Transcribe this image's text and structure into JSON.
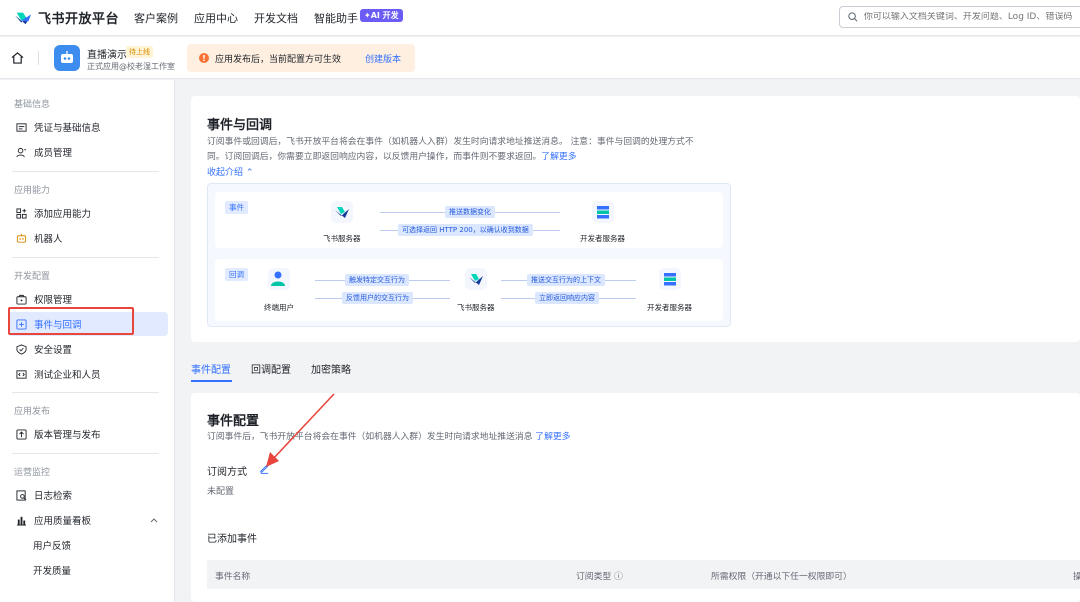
{
  "topnav": {
    "brand": "飞书开放平台",
    "items": [
      "客户案例",
      "应用中心",
      "开发文档",
      "智能助手"
    ],
    "ai_badge": "✦AI 开发",
    "search_placeholder": "你可以输入文档关键词、开发问题、Log ID、错误码"
  },
  "app": {
    "name": "直播演示",
    "status_badge": "待上线",
    "subtitle": "正式应用@校老湿工作室"
  },
  "notice": {
    "text": "应用发布后，当前配置方可生效",
    "link": "创建版本"
  },
  "sidebar": {
    "groups": [
      {
        "title": "基础信息",
        "items": [
          "凭证与基础信息",
          "成员管理"
        ]
      },
      {
        "title": "应用能力",
        "items": [
          "添加应用能力",
          "机器人"
        ]
      },
      {
        "title": "开发配置",
        "items": [
          "权限管理",
          "事件与回调",
          "安全设置",
          "测试企业和人员"
        ]
      },
      {
        "title": "应用发布",
        "items": [
          "版本管理与发布"
        ]
      },
      {
        "title": "运营监控",
        "items": [
          "日志检索",
          "应用质量看板",
          "用户反馈",
          "开发质量"
        ]
      }
    ]
  },
  "intro": {
    "title": "事件与回调",
    "desc_line1": "订阅事件或回调后，飞书开放平台将会在事件（如机器人入群）发生时向请求地址推送消息。 注意：事件与回调的处理方式不",
    "desc_line2": "同。订阅回调后，你需要立即返回响应内容，以反馈用户操作，而事件则不要求返回。",
    "learn_more": "了解更多",
    "collapse": "收起介绍 ⌃"
  },
  "diagram": {
    "event_tag": "事件",
    "callback_tag": "回调",
    "event_push": "推送数据变化",
    "event_return": "可选择返回 HTTP 200，以确认收到数据",
    "feishu_server": "飞书服务器",
    "dev_server": "开发者服务器",
    "end_user": "终端用户",
    "trigger": "触发特定交互行为",
    "feedback": "反馈用户的交互行为",
    "push_context": "推送交互行为的上下文",
    "return_now": "立即返回响应内容"
  },
  "tabs": [
    "事件配置",
    "回调配置",
    "加密策略"
  ],
  "event_config": {
    "title": "事件配置",
    "desc": "订阅事件后，飞书开放平台将会在事件（如机器人入群）发生时向请求地址推送消息",
    "learn_more": "了解更多",
    "sub_method_label": "订阅方式",
    "sub_method_value": "未配置",
    "added_events": "已添加事件",
    "columns": [
      "事件名称",
      "订阅类型 ⓘ",
      "所需权限（开通以下任一权限即可）",
      "操"
    ]
  },
  "colors": {
    "accent": "#3370ff",
    "highlight_box": "#e8453c",
    "ai_badge": "#6b5cf6"
  }
}
